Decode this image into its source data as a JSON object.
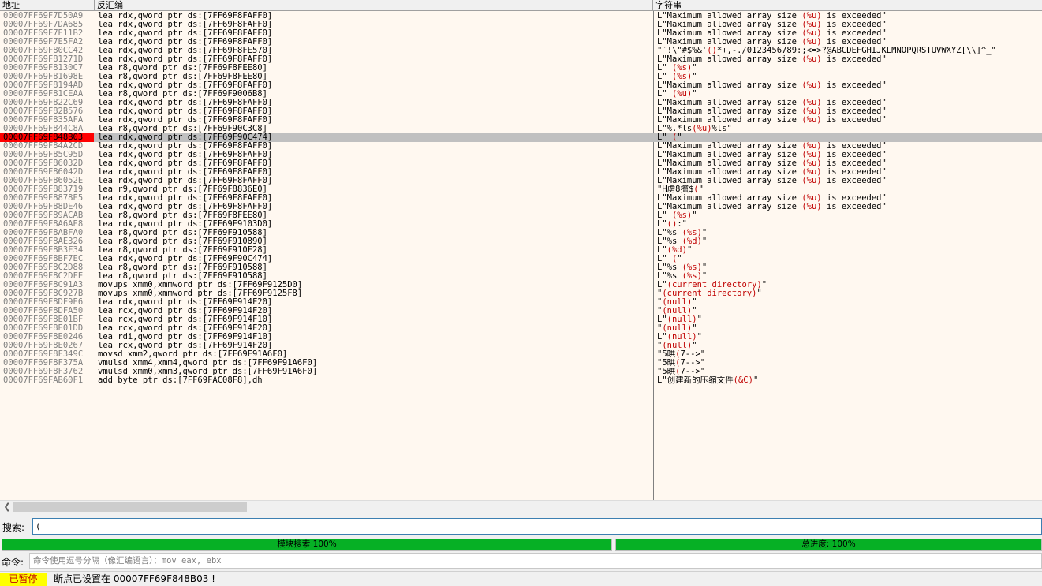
{
  "headers": {
    "address": "地址",
    "disassembly": "反汇编",
    "string": "字符串"
  },
  "rows": [
    {
      "addr": "00007FF69F7D50A9",
      "dis": "lea rdx,qword ptr ds:[7FF69F8FAFF0]",
      "str": [
        [
          "L\"Maximum allowed array size ",
          0
        ],
        [
          "(%u)",
          1
        ],
        [
          " is exceeded\"",
          0
        ]
      ]
    },
    {
      "addr": "00007FF69F7DA685",
      "dis": "lea rdx,qword ptr ds:[7FF69F8FAFF0]",
      "str": [
        [
          "L\"Maximum allowed array size ",
          0
        ],
        [
          "(%u)",
          1
        ],
        [
          " is exceeded\"",
          0
        ]
      ]
    },
    {
      "addr": "00007FF69F7E11B2",
      "dis": "lea rdx,qword ptr ds:[7FF69F8FAFF0]",
      "str": [
        [
          "L\"Maximum allowed array size ",
          0
        ],
        [
          "(%u)",
          1
        ],
        [
          " is exceeded\"",
          0
        ]
      ]
    },
    {
      "addr": "00007FF69F7E5FA2",
      "dis": "lea rdx,qword ptr ds:[7FF69F8FAFF0]",
      "str": [
        [
          "L\"Maximum allowed array size ",
          0
        ],
        [
          "(%u)",
          1
        ],
        [
          " is exceeded\"",
          0
        ]
      ]
    },
    {
      "addr": "00007FF69F80CC42",
      "dis": "lea rdx,qword ptr ds:[7FF69F8FE570]",
      "str": [
        [
          "\"`!\\\"#$%&'",
          0
        ],
        [
          "()",
          1
        ],
        [
          "*+,-./0123456789:;<=>?@ABCDEFGHIJKLMNOPQRSTUVWXYZ[\\\\]^_\"",
          0
        ]
      ]
    },
    {
      "addr": "00007FF69F81271D",
      "dis": "lea rdx,qword ptr ds:[7FF69F8FAFF0]",
      "str": [
        [
          "L\"Maximum allowed array size ",
          0
        ],
        [
          "(%u)",
          1
        ],
        [
          " is exceeded\"",
          0
        ]
      ]
    },
    {
      "addr": "00007FF69F8130C7",
      "dis": "lea r8,qword ptr ds:[7FF69F8FEE80]",
      "str": [
        [
          "L\" ",
          0
        ],
        [
          "(%s)",
          1
        ],
        [
          "\"",
          0
        ]
      ]
    },
    {
      "addr": "00007FF69F81698E",
      "dis": "lea r8,qword ptr ds:[7FF69F8FEE80]",
      "str": [
        [
          "L\" ",
          0
        ],
        [
          "(%s)",
          1
        ],
        [
          "\"",
          0
        ]
      ]
    },
    {
      "addr": "00007FF69F8194AD",
      "dis": "lea rdx,qword ptr ds:[7FF69F8FAFF0]",
      "str": [
        [
          "L\"Maximum allowed array size ",
          0
        ],
        [
          "(%u)",
          1
        ],
        [
          " is exceeded\"",
          0
        ]
      ]
    },
    {
      "addr": "00007FF69F81CEAA",
      "dis": "lea r8,qword ptr ds:[7FF69F9006B8]",
      "str": [
        [
          "L\" ",
          0
        ],
        [
          "(%u)",
          1
        ],
        [
          "\"",
          0
        ]
      ]
    },
    {
      "addr": "00007FF69F822C69",
      "dis": "lea rdx,qword ptr ds:[7FF69F8FAFF0]",
      "str": [
        [
          "L\"Maximum allowed array size ",
          0
        ],
        [
          "(%u)",
          1
        ],
        [
          " is exceeded\"",
          0
        ]
      ]
    },
    {
      "addr": "00007FF69F82B576",
      "dis": "lea rdx,qword ptr ds:[7FF69F8FAFF0]",
      "str": [
        [
          "L\"Maximum allowed array size ",
          0
        ],
        [
          "(%u)",
          1
        ],
        [
          " is exceeded\"",
          0
        ]
      ]
    },
    {
      "addr": "00007FF69F835AFA",
      "dis": "lea rdx,qword ptr ds:[7FF69F8FAFF0]",
      "str": [
        [
          "L\"Maximum allowed array size ",
          0
        ],
        [
          "(%u)",
          1
        ],
        [
          " is exceeded\"",
          0
        ]
      ]
    },
    {
      "addr": "00007FF69F844C8A",
      "dis": "lea r8,qword ptr ds:[7FF69F90C3C8]",
      "str": [
        [
          "L\"%.*ls",
          0
        ],
        [
          "(%u)",
          1
        ],
        [
          "%ls\"",
          0
        ]
      ]
    },
    {
      "addr": "00007FF69F848B03",
      "dis": "lea rdx,qword ptr ds:[7FF69F90C474]",
      "str": [
        [
          "L\" ",
          0
        ],
        [
          "(",
          1
        ],
        [
          "\"",
          0
        ]
      ],
      "selected": true
    },
    {
      "addr": "00007FF69F84A2CD",
      "dis": "lea rdx,qword ptr ds:[7FF69F8FAFF0]",
      "str": [
        [
          "L\"Maximum allowed array size ",
          0
        ],
        [
          "(%u)",
          1
        ],
        [
          " is exceeded\"",
          0
        ]
      ]
    },
    {
      "addr": "00007FF69F85C95D",
      "dis": "lea rdx,qword ptr ds:[7FF69F8FAFF0]",
      "str": [
        [
          "L\"Maximum allowed array size ",
          0
        ],
        [
          "(%u)",
          1
        ],
        [
          " is exceeded\"",
          0
        ]
      ]
    },
    {
      "addr": "00007FF69F86032D",
      "dis": "lea rdx,qword ptr ds:[7FF69F8FAFF0]",
      "str": [
        [
          "L\"Maximum allowed array size ",
          0
        ],
        [
          "(%u)",
          1
        ],
        [
          " is exceeded\"",
          0
        ]
      ]
    },
    {
      "addr": "00007FF69F86042D",
      "dis": "lea rdx,qword ptr ds:[7FF69F8FAFF0]",
      "str": [
        [
          "L\"Maximum allowed array size ",
          0
        ],
        [
          "(%u)",
          1
        ],
        [
          " is exceeded\"",
          0
        ]
      ]
    },
    {
      "addr": "00007FF69F86052E",
      "dis": "lea rdx,qword ptr ds:[7FF69F8FAFF0]",
      "str": [
        [
          "L\"Maximum allowed array size ",
          0
        ],
        [
          "(%u)",
          1
        ],
        [
          " is exceeded\"",
          0
        ]
      ]
    },
    {
      "addr": "00007FF69F883719",
      "dis": "lea r9,qword ptr ds:[7FF69F8836E0]",
      "str": [
        [
          "\"H虏8攛$",
          0
        ],
        [
          "(",
          1
        ],
        [
          "\"",
          0
        ]
      ]
    },
    {
      "addr": "00007FF69F8878E5",
      "dis": "lea rdx,qword ptr ds:[7FF69F8FAFF0]",
      "str": [
        [
          "L\"Maximum allowed array size ",
          0
        ],
        [
          "(%u)",
          1
        ],
        [
          " is exceeded\"",
          0
        ]
      ]
    },
    {
      "addr": "00007FF69F88DE46",
      "dis": "lea rdx,qword ptr ds:[7FF69F8FAFF0]",
      "str": [
        [
          "L\"Maximum allowed array size ",
          0
        ],
        [
          "(%u)",
          1
        ],
        [
          " is exceeded\"",
          0
        ]
      ]
    },
    {
      "addr": "00007FF69F89ACAB",
      "dis": "lea r8,qword ptr ds:[7FF69F8FEE80]",
      "str": [
        [
          "L\" ",
          0
        ],
        [
          "(%s)",
          1
        ],
        [
          "\"",
          0
        ]
      ]
    },
    {
      "addr": "00007FF69F8A6AE8",
      "dis": "lea rdx,qword ptr ds:[7FF69F9103D0]",
      "str": [
        [
          "L\"",
          0
        ],
        [
          "()",
          1
        ],
        [
          ":\"",
          0
        ]
      ]
    },
    {
      "addr": "00007FF69F8ABFA0",
      "dis": "lea r8,qword ptr ds:[7FF69F910588]",
      "str": [
        [
          "L\"%s ",
          0
        ],
        [
          "(%s)",
          1
        ],
        [
          "\"",
          0
        ]
      ]
    },
    {
      "addr": "00007FF69F8AE326",
      "dis": "lea r8,qword ptr ds:[7FF69F910890]",
      "str": [
        [
          "L\"%s ",
          0
        ],
        [
          "(%d)",
          1
        ],
        [
          "\"",
          0
        ]
      ]
    },
    {
      "addr": "00007FF69F8B3F34",
      "dis": "lea r8,qword ptr ds:[7FF69F910F28]",
      "str": [
        [
          "L\"",
          0
        ],
        [
          "(%d)",
          1
        ],
        [
          "\"",
          0
        ]
      ]
    },
    {
      "addr": "00007FF69F8BF7EC",
      "dis": "lea rdx,qword ptr ds:[7FF69F90C474]",
      "str": [
        [
          "L\" ",
          0
        ],
        [
          "(",
          1
        ],
        [
          "\"",
          0
        ]
      ]
    },
    {
      "addr": "00007FF69F8C2D88",
      "dis": "lea r8,qword ptr ds:[7FF69F910588]",
      "str": [
        [
          "L\"%s ",
          0
        ],
        [
          "(%s)",
          1
        ],
        [
          "\"",
          0
        ]
      ]
    },
    {
      "addr": "00007FF69F8C2DFE",
      "dis": "lea r8,qword ptr ds:[7FF69F910588]",
      "str": [
        [
          "L\"%s ",
          0
        ],
        [
          "(%s)",
          1
        ],
        [
          "\"",
          0
        ]
      ]
    },
    {
      "addr": "00007FF69F8C91A3",
      "dis": "movups xmm0,xmmword ptr ds:[7FF69F9125D0]",
      "str": [
        [
          "L\"",
          0
        ],
        [
          "(current directory)",
          1
        ],
        [
          "\"",
          0
        ]
      ]
    },
    {
      "addr": "00007FF69F8C927B",
      "dis": "movups xmm0,xmmword ptr ds:[7FF69F9125F8]",
      "str": [
        [
          "\"",
          0
        ],
        [
          "(current directory)",
          1
        ],
        [
          "\"",
          0
        ]
      ]
    },
    {
      "addr": "00007FF69F8DF9E6",
      "dis": "lea rdx,qword ptr ds:[7FF69F914F20]",
      "str": [
        [
          "\"",
          0
        ],
        [
          "(null)",
          1
        ],
        [
          "\"",
          0
        ]
      ]
    },
    {
      "addr": "00007FF69F8DFA50",
      "dis": "lea rcx,qword ptr ds:[7FF69F914F20]",
      "str": [
        [
          "\"",
          0
        ],
        [
          "(null)",
          1
        ],
        [
          "\"",
          0
        ]
      ]
    },
    {
      "addr": "00007FF69F8E01BF",
      "dis": "lea rcx,qword ptr ds:[7FF69F914F10]",
      "str": [
        [
          "L\"",
          0
        ],
        [
          "(null)",
          1
        ],
        [
          "\"",
          0
        ]
      ]
    },
    {
      "addr": "00007FF69F8E01DD",
      "dis": "lea rcx,qword ptr ds:[7FF69F914F20]",
      "str": [
        [
          "\"",
          0
        ],
        [
          "(null)",
          1
        ],
        [
          "\"",
          0
        ]
      ]
    },
    {
      "addr": "00007FF69F8E0246",
      "dis": "lea rdi,qword ptr ds:[7FF69F914F10]",
      "str": [
        [
          "L\"",
          0
        ],
        [
          "(null)",
          1
        ],
        [
          "\"",
          0
        ]
      ]
    },
    {
      "addr": "00007FF69F8E0267",
      "dis": "lea rcx,qword ptr ds:[7FF69F914F20]",
      "str": [
        [
          "\"",
          0
        ],
        [
          "(null)",
          1
        ],
        [
          "\"",
          0
        ]
      ]
    },
    {
      "addr": "00007FF69F8F349C",
      "dis": "movsd xmm2,qword ptr ds:[7FF69F91A6F0]",
      "str": [
        [
          "\"5晎",
          0
        ],
        [
          "(",
          1
        ],
        [
          "7-->\"",
          0
        ]
      ]
    },
    {
      "addr": "00007FF69F8F375A",
      "dis": "vmulsd xmm4,xmm4,qword ptr ds:[7FF69F91A6F0]",
      "str": [
        [
          "\"5晎",
          0
        ],
        [
          "(",
          1
        ],
        [
          "7-->\"",
          0
        ]
      ]
    },
    {
      "addr": "00007FF69F8F3762",
      "dis": "vmulsd xmm0,xmm3,qword ptr ds:[7FF69F91A6F0]",
      "str": [
        [
          "\"5晎",
          0
        ],
        [
          "(",
          1
        ],
        [
          "7-->\"",
          0
        ]
      ]
    },
    {
      "addr": "00007FF69FAB60F1",
      "dis": "add byte ptr ds:[7FF69FAC08F8],dh",
      "str": [
        [
          "L\"创建新的压缩文件",
          0
        ],
        [
          "(&C)",
          1
        ],
        [
          "\"",
          0
        ]
      ]
    }
  ],
  "search": {
    "label": "搜索:",
    "value": "("
  },
  "progress": {
    "module": {
      "label": "模块搜索 100%",
      "percent": 100
    },
    "total": {
      "label": "总进度: 100%",
      "percent": 100
    }
  },
  "command": {
    "label": "命令:",
    "placeholder": "命令使用逗号分隔（像汇编语言）：mov eax, ebx"
  },
  "status": {
    "state": "已暂停",
    "message": "断点已设置在 00007FF69F848B03 !"
  },
  "colors": {
    "selected_row": "#c0c0c0",
    "selected_addr": "#ff0000",
    "format_text": "#c00000",
    "progress_fill": "#06b025",
    "state_badge": "#ffff00"
  },
  "icons": {
    "scroll_left": "chevron-left-icon"
  }
}
